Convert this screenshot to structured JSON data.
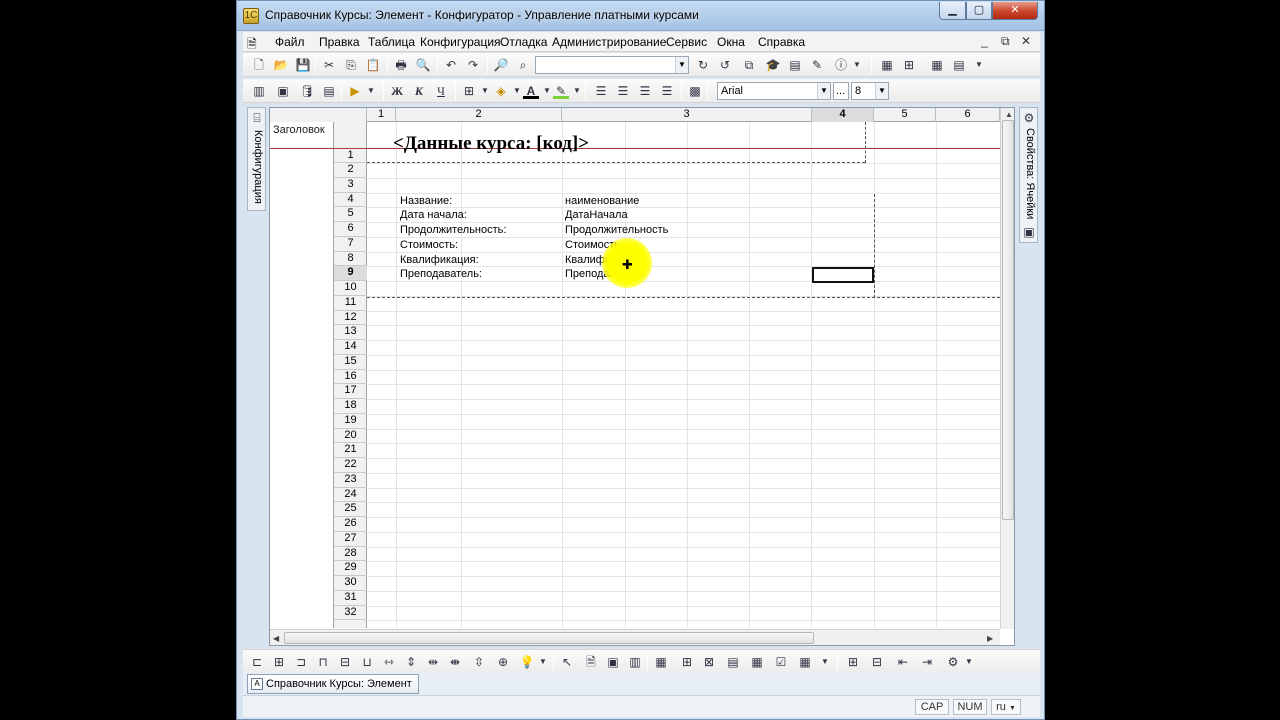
{
  "window": {
    "title": "Справочник Курсы: Элемент - Конфигуратор - Управление платными курсами",
    "app_icon": "1c-icon"
  },
  "menu": {
    "items": [
      "Файл",
      "Правка",
      "Таблица",
      "Конфигурация",
      "Отладка",
      "Администрирование",
      "Сервис",
      "Окна",
      "Справка"
    ]
  },
  "toolbar": {
    "font_name": "Arial",
    "font_size": "8",
    "bold_label": "Ж",
    "italic_label": "К",
    "underline_label": "Ч",
    "zoom_label": "..."
  },
  "left_panel": {
    "label": "Конфигурация"
  },
  "right_panel": {
    "label": "Свойства: Ячейки"
  },
  "sheet": {
    "column_headers": [
      "1",
      "2",
      "3",
      "4",
      "5",
      "6"
    ],
    "selected_column": "4",
    "group_label": "Заголовок",
    "row_numbers": [
      "1",
      "2",
      "3",
      "4",
      "5",
      "6",
      "7",
      "8",
      "9",
      "10",
      "11",
      "12",
      "13",
      "14",
      "15",
      "16",
      "17",
      "18",
      "19",
      "20",
      "21",
      "22",
      "23",
      "24",
      "25",
      "26",
      "27",
      "28",
      "29",
      "30",
      "31",
      "32"
    ],
    "selected_row": "9",
    "heading": "<Данные курса: [код]>",
    "fields": [
      {
        "label": "Название:",
        "value": "наименование"
      },
      {
        "label": "Дата начала:",
        "value": "ДатаНачала"
      },
      {
        "label": "Продолжительность:",
        "value": "Продолжительность"
      },
      {
        "label": "Стоимость:",
        "value": "Стоимость"
      },
      {
        "label": "Квалификация:",
        "value": "Квалификация"
      },
      {
        "label": "Преподаватель:",
        "value": "Преподаватель"
      }
    ]
  },
  "taskbar": {
    "active_window": "Справочник Курсы: Элемент"
  },
  "status": {
    "cap": "CAP",
    "num": "NUM",
    "lang": "ru"
  },
  "colors": {
    "title_bar": "#b3cde9",
    "close_button": "#c9442b",
    "group_line": "#a83b3b",
    "cursor_highlight": "#ffff00"
  }
}
